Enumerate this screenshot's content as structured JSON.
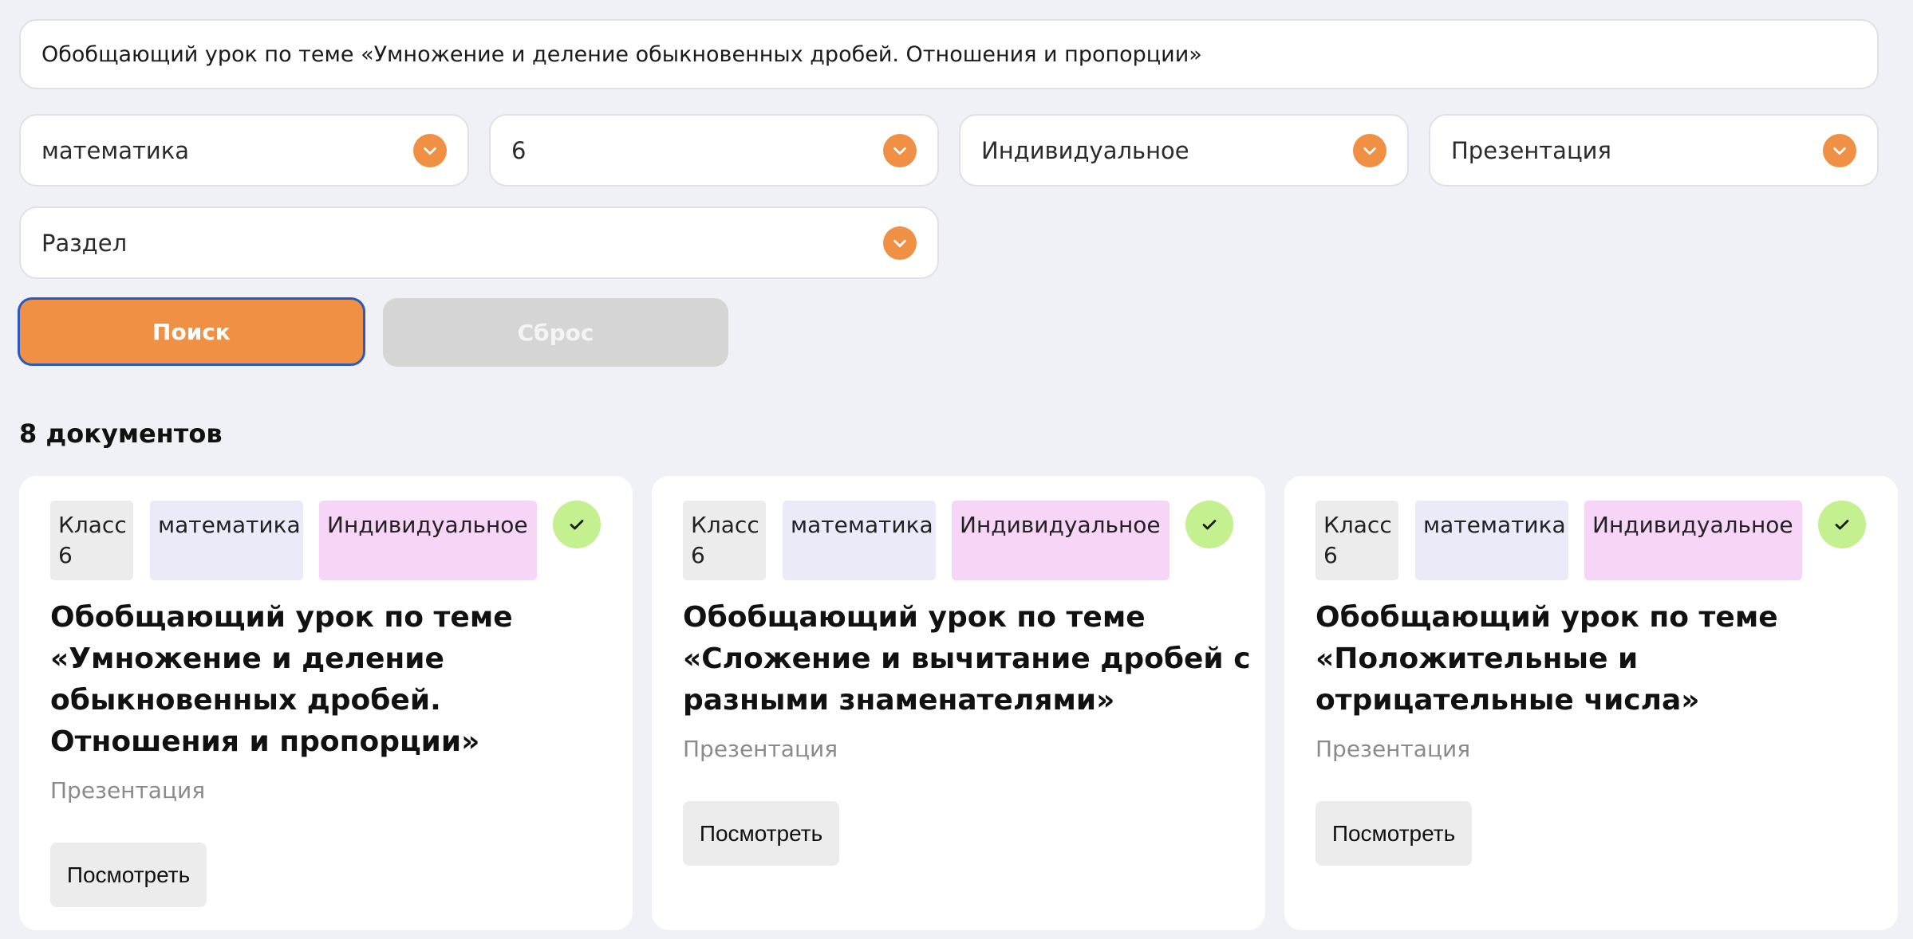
{
  "search": {
    "value": "Обобщающий урок по теме «Умножение и деление обыкновенных дробей. Отношения и пропорции»"
  },
  "filters": {
    "subject": "математика",
    "grade": "6",
    "mode": "Индивидуальное",
    "type": "Презентация",
    "section": "Раздел"
  },
  "buttons": {
    "search": "Поиск",
    "reset": "Сброс"
  },
  "results": {
    "count_label": "8 документов",
    "cards": [
      {
        "class_tag": "Класс 6",
        "subject_tag": "математика",
        "mode_tag": "Индивидуальное",
        "title": "Обобщающий урок по теме «Умножение и деление обыкновенных дробей. Отношения и пропорции»",
        "type": "Презентация",
        "view_label": "Посмотреть"
      },
      {
        "class_tag": "Класс 6",
        "subject_tag": "математика",
        "mode_tag": "Индивидуальное",
        "title": "Обобщающий урок по теме «Сложение и вычитание дробей с разными знаменателями»",
        "type": "Презентация",
        "view_label": "Посмотреть"
      },
      {
        "class_tag": "Класс 6",
        "subject_tag": "математика",
        "mode_tag": "Индивидуальное",
        "title": "Обобщающий урок по теме «Положительные и отрицательные числа»",
        "type": "Презентация",
        "view_label": "Посмотреть"
      }
    ]
  },
  "icons": {
    "dropdown": "chevron-down-icon",
    "verified": "check-icon"
  },
  "colors": {
    "accent": "#ef9044",
    "check_bg": "#c4f08f",
    "subject_tag_bg": "#ebeaf9",
    "mode_tag_bg": "#f7d5f7"
  }
}
